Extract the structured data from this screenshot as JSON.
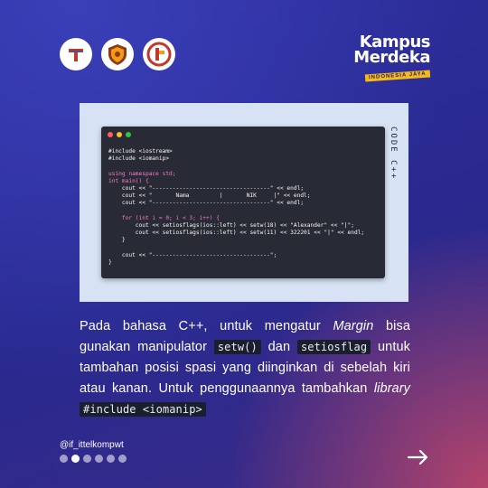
{
  "logos": {
    "logo1": {
      "name": "tut-wuri-handayani-logo"
    },
    "logo2": {
      "name": "shield-logo"
    },
    "logo3": {
      "name": "telkom-logo"
    }
  },
  "brand": {
    "line1": "Kampus",
    "line2": "Merdeka",
    "tagline": "INDONESIA JAYA"
  },
  "side_label": "CODE C++",
  "code": {
    "lines": [
      "#include <iostream>",
      "#include <iomanip>",
      "",
      "using namespace std;",
      "int main() {",
      "    cout << \"-----------------------------------\" << endl;",
      "    cout << \"       Nama         |       NIK     |\" << endl;",
      "    cout << \"-----------------------------------\" << endl;",
      "",
      "    for (int i = 0; i < 3; i++) {",
      "        cout << setiosflags(ios::left) << setw(18) << \"Alexander\" << \"|\";",
      "        cout << setiosflags(ios::left) << setw(11) << 322201 << \"|\" << endl;",
      "    }",
      "",
      "    cout << \"-----------------------------------\";",
      "}"
    ]
  },
  "body": {
    "t1": "Pada bahasa C++, untuk mengatur ",
    "t1_em": "Margin",
    "t1b": " bisa gunakan manipulator ",
    "code1": "setw()",
    "t2": " dan ",
    "code2": "setiosflag",
    "t3": " untuk tambahan posisi spasi yang diinginkan di sebelah kiri atau kanan. Untuk penggunaannya tambahkan ",
    "t3_em": "library",
    "t3b": " ",
    "code3": "#include <iomanip>"
  },
  "handle": "@if_ittelkompwt",
  "pager": {
    "count": 6,
    "active": 1
  },
  "colors": {
    "bg": "#2c2d9c",
    "accent": "#f6b91a",
    "editor": "#282a36"
  }
}
